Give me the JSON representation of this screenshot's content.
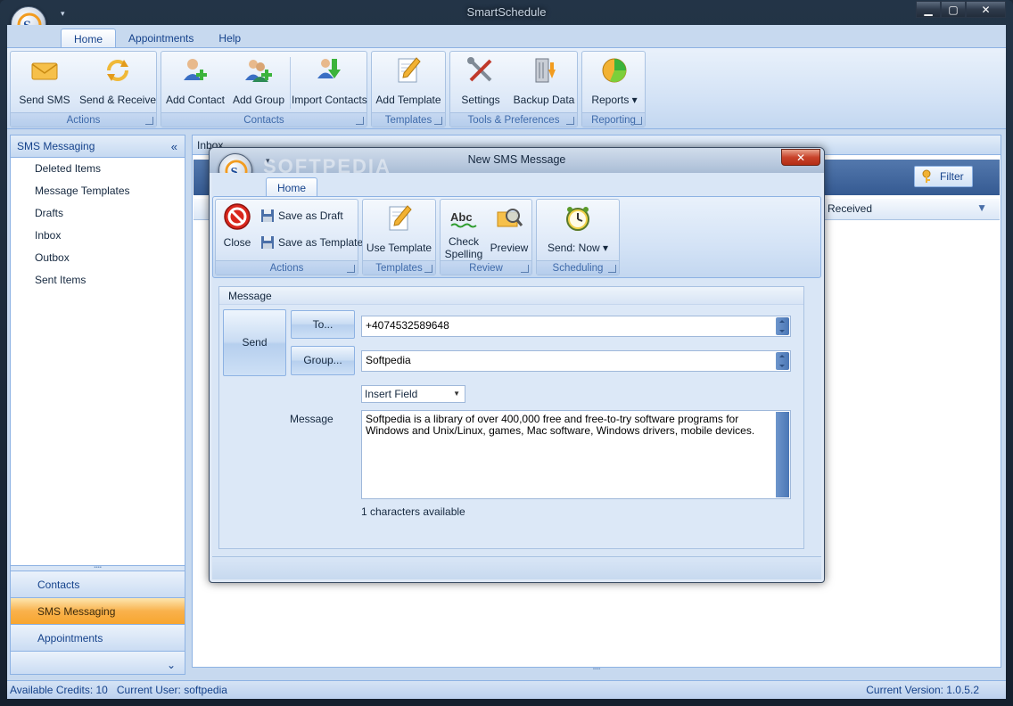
{
  "app": {
    "title": "SmartSchedule"
  },
  "tabs": [
    {
      "label": "Home"
    },
    {
      "label": "Appointments"
    },
    {
      "label": "Help"
    }
  ],
  "ribbon": {
    "actions": {
      "label": "Actions",
      "send_sms": "Send SMS",
      "send_receive": "Send & Receive"
    },
    "contacts": {
      "label": "Contacts",
      "add_contact": "Add Contact",
      "add_group": "Add Group",
      "import_contacts": "Import Contacts"
    },
    "templates": {
      "label": "Templates",
      "add_template": "Add Template"
    },
    "tools": {
      "label": "Tools & Preferences",
      "settings": "Settings",
      "backup_data": "Backup Data"
    },
    "reporting": {
      "label": "Reporting",
      "reports": "Reports ▾"
    }
  },
  "nav": {
    "header": "SMS Messaging",
    "items": [
      {
        "label": "Deleted Items"
      },
      {
        "label": "Message Templates"
      },
      {
        "label": "Drafts"
      },
      {
        "label": "Inbox"
      },
      {
        "label": "Outbox"
      },
      {
        "label": "Sent Items"
      }
    ],
    "buttons": [
      {
        "label": "Contacts"
      },
      {
        "label": "SMS Messaging"
      },
      {
        "label": "Appointments"
      }
    ]
  },
  "inbox": {
    "title": "Inbox",
    "filter_label": "Filter",
    "column_received": "Received"
  },
  "status": {
    "credits": "Available Credits: 10",
    "user": "Current User: softpedia",
    "version": "Current Version: 1.0.5.2"
  },
  "dialog": {
    "title": "New SMS Message",
    "watermark": "SOFTPEDIA",
    "tab": "Home",
    "ribbon": {
      "actions": {
        "label": "Actions",
        "close": "Close",
        "save_draft": "Save as Draft",
        "save_template": "Save as Template"
      },
      "templates": {
        "label": "Templates",
        "use_template": "Use Template"
      },
      "review": {
        "label": "Review",
        "check": "Check",
        "spelling": "Spelling",
        "preview": "Preview"
      },
      "scheduling": {
        "label": "Scheduling",
        "send_now": "Send: Now ▾"
      }
    },
    "message_section": "Message",
    "send_label": "Send",
    "to_label": "To...",
    "group_label": "Group...",
    "to_value": "+4074532589648",
    "group_value": "Softpedia",
    "insert_field": "Insert Field",
    "message_label": "Message",
    "message_text": "Softpedia is a library of over 400,000 free and free-to-try software programs for Windows and Unix/Linux, games, Mac software, Windows drivers, mobile devices.",
    "chars_available": "1 characters available"
  }
}
